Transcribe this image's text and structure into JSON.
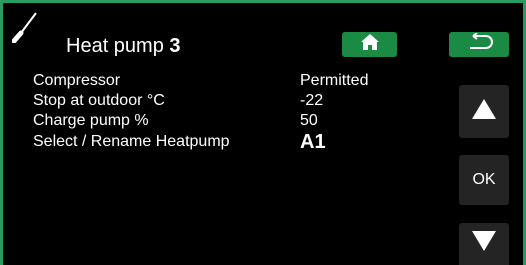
{
  "header": {
    "title": "Heat pump",
    "number": "3",
    "tool_icon": "screwdriver-icon",
    "home_icon": "home-icon",
    "back_icon": "back-arrow-icon",
    "button_color": "#1a8a45",
    "frame_color": "#2a9a63"
  },
  "settings": [
    {
      "label": "Compressor",
      "value": "Permitted"
    },
    {
      "label": "Stop at outdoor °C",
      "value": "-22"
    },
    {
      "label": "Charge pump %",
      "value": "50"
    },
    {
      "label": "Select / Rename Heatpump",
      "value": "A1"
    }
  ],
  "nav": {
    "up_icon": "arrow-up-icon",
    "ok_label": "OK",
    "down_icon": "arrow-down-icon"
  }
}
